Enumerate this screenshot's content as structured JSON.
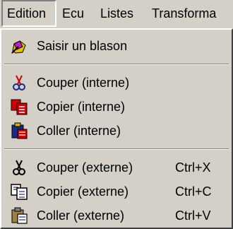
{
  "menubar": {
    "items": [
      {
        "label": "Edition"
      },
      {
        "label": "Ecu"
      },
      {
        "label": "Listes"
      },
      {
        "label": "Transforma"
      }
    ]
  },
  "menu": {
    "saisir": {
      "label": "Saisir un blason",
      "icon": "pen-icon"
    },
    "internal": [
      {
        "label": "Couper (interne)",
        "icon": "scissors-icon-red"
      },
      {
        "label": "Copier (interne)",
        "icon": "copy-icon-red"
      },
      {
        "label": "Coller (interne)",
        "icon": "paste-icon-color"
      }
    ],
    "external": [
      {
        "label": "Couper (externe)",
        "shortcut": "Ctrl+X",
        "icon": "scissors-icon"
      },
      {
        "label": "Copier (externe)",
        "shortcut": "Ctrl+C",
        "icon": "copy-icon"
      },
      {
        "label": "Coller (externe)",
        "shortcut": "Ctrl+V",
        "icon": "paste-icon"
      }
    ]
  },
  "colors": {
    "menu_bg": "#d4d0c8",
    "red": "#d40000",
    "navy": "#1a2a8a"
  }
}
